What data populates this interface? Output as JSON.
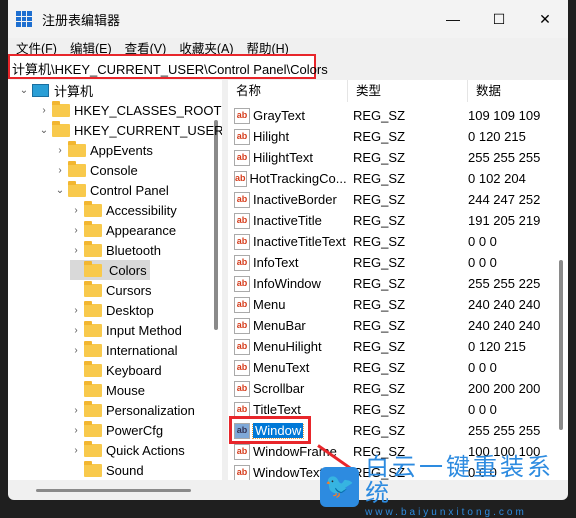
{
  "window": {
    "title": "注册表编辑器",
    "minimize": "—",
    "maximize": "☐",
    "close": "✕"
  },
  "menu": [
    "文件(F)",
    "编辑(E)",
    "查看(V)",
    "收藏夹(A)",
    "帮助(H)"
  ],
  "address": "计算机\\HKEY_CURRENT_USER\\Control Panel\\Colors",
  "tree": [
    {
      "label": "计算机",
      "level": 0,
      "state": "open",
      "icon": "computer-icon"
    },
    {
      "label": "HKEY_CLASSES_ROOT",
      "level": 1,
      "state": "closed"
    },
    {
      "label": "HKEY_CURRENT_USER",
      "level": 1,
      "state": "open"
    },
    {
      "label": "AppEvents",
      "level": 2,
      "state": "closed"
    },
    {
      "label": "Console",
      "level": 2,
      "state": "closed"
    },
    {
      "label": "Control Panel",
      "level": 2,
      "state": "open"
    },
    {
      "label": "Accessibility",
      "level": 3,
      "state": "closed"
    },
    {
      "label": "Appearance",
      "level": 3,
      "state": "closed"
    },
    {
      "label": "Bluetooth",
      "level": 3,
      "state": "closed"
    },
    {
      "label": "Colors",
      "level": 3,
      "state": "leaf",
      "selected": true
    },
    {
      "label": "Cursors",
      "level": 3,
      "state": "leaf"
    },
    {
      "label": "Desktop",
      "level": 3,
      "state": "closed"
    },
    {
      "label": "Input Method",
      "level": 3,
      "state": "closed"
    },
    {
      "label": "International",
      "level": 3,
      "state": "closed"
    },
    {
      "label": "Keyboard",
      "level": 3,
      "state": "leaf"
    },
    {
      "label": "Mouse",
      "level": 3,
      "state": "leaf"
    },
    {
      "label": "Personalization",
      "level": 3,
      "state": "closed"
    },
    {
      "label": "PowerCfg",
      "level": 3,
      "state": "closed"
    },
    {
      "label": "Quick Actions",
      "level": 3,
      "state": "closed"
    },
    {
      "label": "Sound",
      "level": 3,
      "state": "leaf"
    }
  ],
  "columns": {
    "name": "名称",
    "type": "类型",
    "data": "数据"
  },
  "values": [
    {
      "name": "GrayText",
      "type": "REG_SZ",
      "data": "109 109 109"
    },
    {
      "name": "Hilight",
      "type": "REG_SZ",
      "data": "0 120 215"
    },
    {
      "name": "HilightText",
      "type": "REG_SZ",
      "data": "255 255 255"
    },
    {
      "name": "HotTrackingCo...",
      "type": "REG_SZ",
      "data": "0 102 204"
    },
    {
      "name": "InactiveBorder",
      "type": "REG_SZ",
      "data": "244 247 252"
    },
    {
      "name": "InactiveTitle",
      "type": "REG_SZ",
      "data": "191 205 219"
    },
    {
      "name": "InactiveTitleText",
      "type": "REG_SZ",
      "data": "0 0 0"
    },
    {
      "name": "InfoText",
      "type": "REG_SZ",
      "data": "0 0 0"
    },
    {
      "name": "InfoWindow",
      "type": "REG_SZ",
      "data": "255 255 225"
    },
    {
      "name": "Menu",
      "type": "REG_SZ",
      "data": "240 240 240"
    },
    {
      "name": "MenuBar",
      "type": "REG_SZ",
      "data": "240 240 240"
    },
    {
      "name": "MenuHilight",
      "type": "REG_SZ",
      "data": "0 120 215"
    },
    {
      "name": "MenuText",
      "type": "REG_SZ",
      "data": "0 0 0"
    },
    {
      "name": "Scrollbar",
      "type": "REG_SZ",
      "data": "200 200 200"
    },
    {
      "name": "TitleText",
      "type": "REG_SZ",
      "data": "0 0 0"
    },
    {
      "name": "Window",
      "type": "REG_SZ",
      "data": "255 255 255",
      "selected": true
    },
    {
      "name": "WindowFrame",
      "type": "REG_SZ",
      "data": "100 100 100"
    },
    {
      "name": "WindowText",
      "type": "REG_SZ",
      "data": "0 0 0"
    }
  ],
  "value_icon": "ab",
  "watermark": {
    "title": "白云一键重装系统",
    "url": "www.baiyunxitong.com"
  },
  "colors": {
    "highlight": "#0078d7",
    "annotation": "#e8262b",
    "watermark": "#2d8be0"
  }
}
